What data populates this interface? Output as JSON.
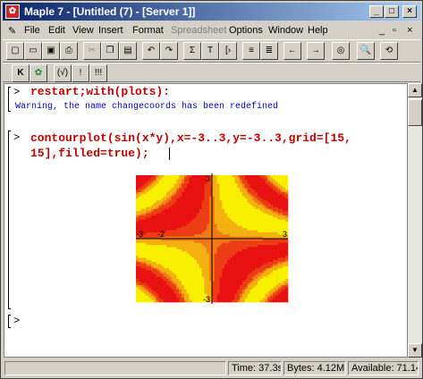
{
  "window": {
    "title": "Maple 7 - [Untitled (7) - [Server 1]]",
    "app_icon": "maple-leaf-icon"
  },
  "window_controls": {
    "minimize": "_",
    "maximize": "□",
    "close": "×"
  },
  "menu": {
    "items": [
      {
        "label": "File"
      },
      {
        "label": "Edit"
      },
      {
        "label": "View"
      },
      {
        "label": "Insert"
      },
      {
        "label": "Format"
      },
      {
        "label": "Spreadsheet",
        "disabled": true
      },
      {
        "label": "Options"
      },
      {
        "label": "Window"
      },
      {
        "label": "Help"
      }
    ],
    "doc_controls": {
      "minimize": "_",
      "restore": "▫",
      "close": "×"
    }
  },
  "toolbar2": {
    "k_label": "K",
    "b1": "(√)",
    "b2": "!",
    "b3": "!!!"
  },
  "worksheet": {
    "input1": "restart;with(plots):",
    "output1": "Warning, the name changecoords has been redefined",
    "input2_line1": "contourplot(sin(x*y),x=-3..3,y=-3..3,grid=[15,",
    "input2_line2": "15],filled=true);",
    "prompt": ">",
    "plot": {
      "tick_top": "3",
      "tick_bottom": "-3",
      "tick_left": "-3",
      "tick_left2": "-2",
      "tick_right": "3"
    }
  },
  "chart_data": {
    "type": "heatmap",
    "title": "",
    "function": "sin(x*y)",
    "x_range": [
      -3,
      3
    ],
    "y_range": [
      -3,
      3
    ],
    "grid": [
      15,
      15
    ],
    "filled": true,
    "colors": {
      "low": "#e81010",
      "mid": "#f07818",
      "high": "#f8f000"
    }
  },
  "status": {
    "time": "Time: 37.3s",
    "bytes": "Bytes: 4.12M",
    "available": "Available: 71.14"
  }
}
